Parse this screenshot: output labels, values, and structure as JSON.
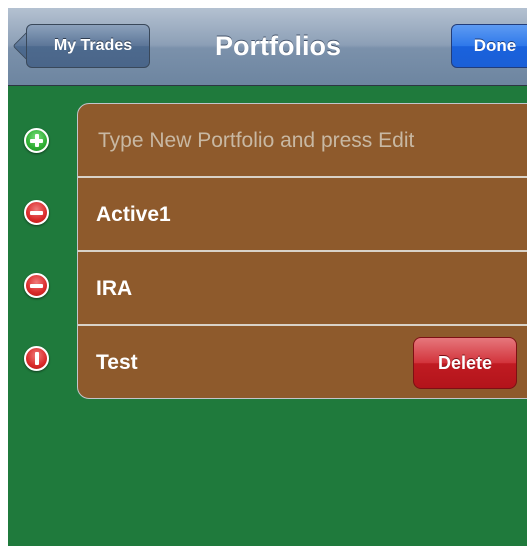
{
  "nav": {
    "back_label": "My Trades",
    "title": "Portfolios",
    "done_label": "Done"
  },
  "table": {
    "new_row_placeholder": "Type New Portfolio and press Edit",
    "rows": [
      {
        "label": "Active1",
        "control": "remove-circle-icon"
      },
      {
        "label": "IRA",
        "control": "remove-circle-icon"
      },
      {
        "label": "Test",
        "control": "delete-confirm-icon",
        "delete_label": "Delete"
      }
    ]
  },
  "icons": {
    "insert": "add-circle-icon",
    "remove": "remove-circle-icon",
    "confirm": "delete-confirm-icon"
  },
  "colors": {
    "background": "#1f7a3c",
    "row": "#8e5a2c",
    "navbar": "#7b91ab",
    "done": "#1b5fd6",
    "delete": "#c01b22"
  }
}
